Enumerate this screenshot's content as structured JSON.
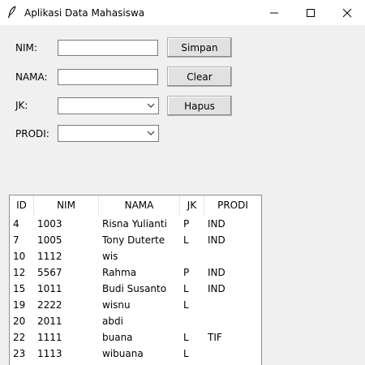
{
  "window": {
    "title": "Aplikasi Data Mahasiswa",
    "icon": "feather-icon"
  },
  "form": {
    "nim_label": "NIM:",
    "nama_label": "NAMA:",
    "jk_label": "JK:",
    "prodi_label": "PRODI:",
    "nim_value": "",
    "nama_value": "",
    "jk_value": "",
    "prodi_value": ""
  },
  "buttons": {
    "simpan": "Simpan",
    "clear": "Clear",
    "hapus": "Hapus"
  },
  "table": {
    "columns": [
      "ID",
      "NIM",
      "NAMA",
      "JK",
      "PRODI"
    ],
    "rows": [
      [
        "4",
        "1003",
        "Risna Yulianti",
        "P",
        "IND"
      ],
      [
        "7",
        "1005",
        "Tony Duterte",
        "L",
        "IND"
      ],
      [
        "10",
        "1112",
        "wis",
        "",
        ""
      ],
      [
        "12",
        "5567",
        "Rahma",
        "P",
        "IND"
      ],
      [
        "15",
        "1011",
        "Budi Susanto",
        "L",
        "IND"
      ],
      [
        "19",
        "2222",
        "wisnu",
        "L",
        ""
      ],
      [
        "20",
        "2011",
        "abdi",
        "",
        ""
      ],
      [
        "22",
        "1111",
        "buana",
        "L",
        "TIF"
      ],
      [
        "23",
        "1113",
        "wibuana",
        "L",
        ""
      ]
    ]
  }
}
